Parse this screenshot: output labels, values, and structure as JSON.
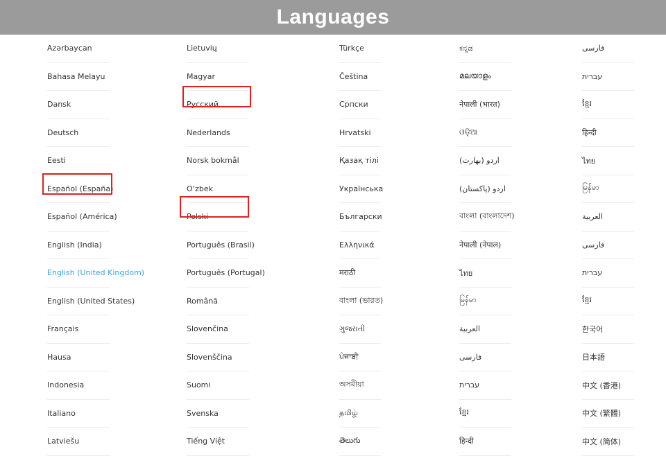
{
  "header": {
    "title": "Languages"
  },
  "columns": [
    [
      "Azərbaycan",
      "Bahasa Melayu",
      "Dansk",
      "Deutsch",
      "Eesti",
      "Español (España)",
      "Español (América)",
      "English (India)",
      "English (United Kingdom)",
      "English (United States)",
      "Français",
      "Hausa",
      "Indonesia",
      "Italiano",
      "Latviešu"
    ],
    [
      "Lietuvių",
      "Magyar",
      "Русский",
      "Nederlands",
      "Norsk bokmål",
      "O‘zbek",
      "Polski",
      "Português (Brasil)",
      "Português (Portugal)",
      "Română",
      "Slovenčina",
      "Slovenščina",
      "Suomi",
      "Svenska",
      "Tiếng Việt"
    ],
    [
      "Türkçe",
      "Čeština",
      "Српски",
      "Hrvatski",
      "Қазақ тілі",
      "Українська",
      "Български",
      "Ελληνικά",
      "मराठी",
      "বাংলা (ভারত)",
      "ગુજરાતી",
      "ਪੰਜਾਬੀ",
      "অসমীয়া",
      "தமிழ்",
      "తెలుగు"
    ],
    [
      "ಕನ್ನಡ",
      "മലയാളം",
      "नेपाली (भारत)",
      "ଓଡ଼ିଆ",
      "اردو (بھارت)",
      "اردو (پاکستان)",
      "বাংলা (বাংলাদেশ)",
      "नेपाली (नेपाल)",
      "ไทย",
      "မြန်မာ",
      "العربية",
      "فارسی",
      "עברית",
      "ខ្មែរ",
      "हिन्दी"
    ],
    [
      "فارسی",
      "עברית",
      "ខ្មែរ",
      "हिन्दी",
      "ไทย",
      "မြန်မာ",
      "العربية",
      "فارسی",
      "עברית",
      "ខ្មែរ",
      "한국어",
      "日本語",
      "中文 (香港)",
      "中文 (繁體)",
      "中文 (简体)"
    ]
  ],
  "selected_language": "English (United Kingdom)",
  "highlighted": [
    "Español (España)",
    "Русский",
    "Polski"
  ],
  "colors": {
    "header_bg": "#9b9b9b",
    "selected": "#3ba2e0",
    "highlight_box": "#e02020"
  }
}
